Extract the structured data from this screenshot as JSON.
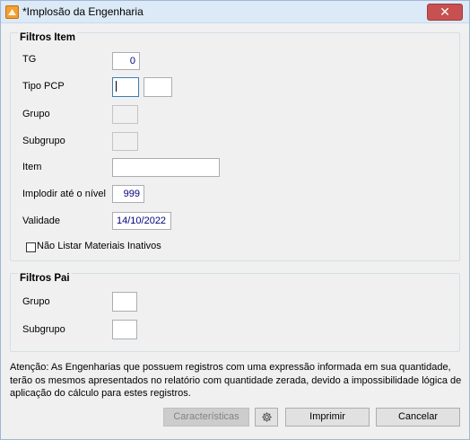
{
  "window": {
    "title": "*Implosão da Engenharia",
    "close_glyph": "✕"
  },
  "filtros_item": {
    "title": "Filtros Item",
    "tg_label": "TG",
    "tg_value": "0",
    "tipo_pcp_label": "Tipo PCP",
    "tipo_pcp_value_1": "",
    "tipo_pcp_value_2": "",
    "grupo_label": "Grupo",
    "subgrupo_label": "Subgrupo",
    "item_label": "Item",
    "item_value": "",
    "implodir_label": "Implodir até o nível",
    "implodir_value": "999",
    "validade_label": "Validade",
    "validade_value": "14/10/2022",
    "nao_listar_label": "Não Listar Materiais Inativos",
    "nao_listar_checked": false
  },
  "filtros_pai": {
    "title": "Filtros Pai",
    "grupo_label": "Grupo",
    "grupo_value": "",
    "subgrupo_label": "Subgrupo",
    "subgrupo_value": ""
  },
  "notice": "Atenção: As Engenharias que possuem registros com uma expressão informada em sua quantidade, terão os mesmos apresentados no relatório com quantidade zerada, devido a impossibilidade lógica de aplicação do cálculo para estes registros.",
  "buttons": {
    "caracteristicas": "Características",
    "settings_icon": "gear-icon",
    "imprimir": "Imprimir",
    "cancelar": "Cancelar"
  },
  "colors": {
    "title_bar": "#dce9f7",
    "close_button": "#c75050",
    "panel_background": "#f0f0f0",
    "value_text_blue": "#000080"
  }
}
